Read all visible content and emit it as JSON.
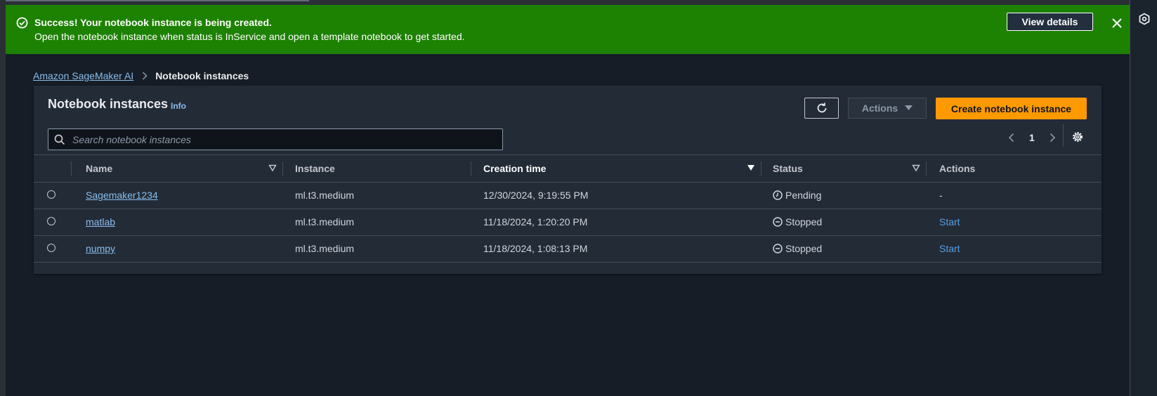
{
  "flash": {
    "title": "Success! Your notebook instance is being created.",
    "message": "Open the notebook instance when status is InService and open a template notebook to get started.",
    "button_label": "View details",
    "color": "#1d8102"
  },
  "breadcrumb": {
    "root": "Amazon SageMaker AI",
    "current": "Notebook instances"
  },
  "panel": {
    "title": "Notebook instances",
    "info": "Info",
    "actions_label": "Actions",
    "create_label": "Create notebook instance",
    "search_placeholder": "Search notebook instances",
    "page": "1"
  },
  "table": {
    "columns": [
      "Name",
      "Instance",
      "Creation time",
      "Status",
      "Actions"
    ],
    "rows": [
      {
        "name": "Sagemaker1234",
        "instance": "ml.t3.medium",
        "created": "12/30/2024, 9:19:55 PM",
        "status": "Pending",
        "status_icon": "clock-icon",
        "action": "-"
      },
      {
        "name": "matlab",
        "instance": "ml.t3.medium",
        "created": "11/18/2024, 1:20:20 PM",
        "status": "Stopped",
        "status_icon": "stopped-icon",
        "action": "Start"
      },
      {
        "name": "numpy",
        "instance": "ml.t3.medium",
        "created": "11/18/2024, 1:08:13 PM",
        "status": "Stopped",
        "status_icon": "stopped-icon",
        "action": "Start"
      }
    ]
  },
  "colors": {
    "accent": "#ff9900",
    "link": "#89bdee",
    "background": "#161d26"
  }
}
